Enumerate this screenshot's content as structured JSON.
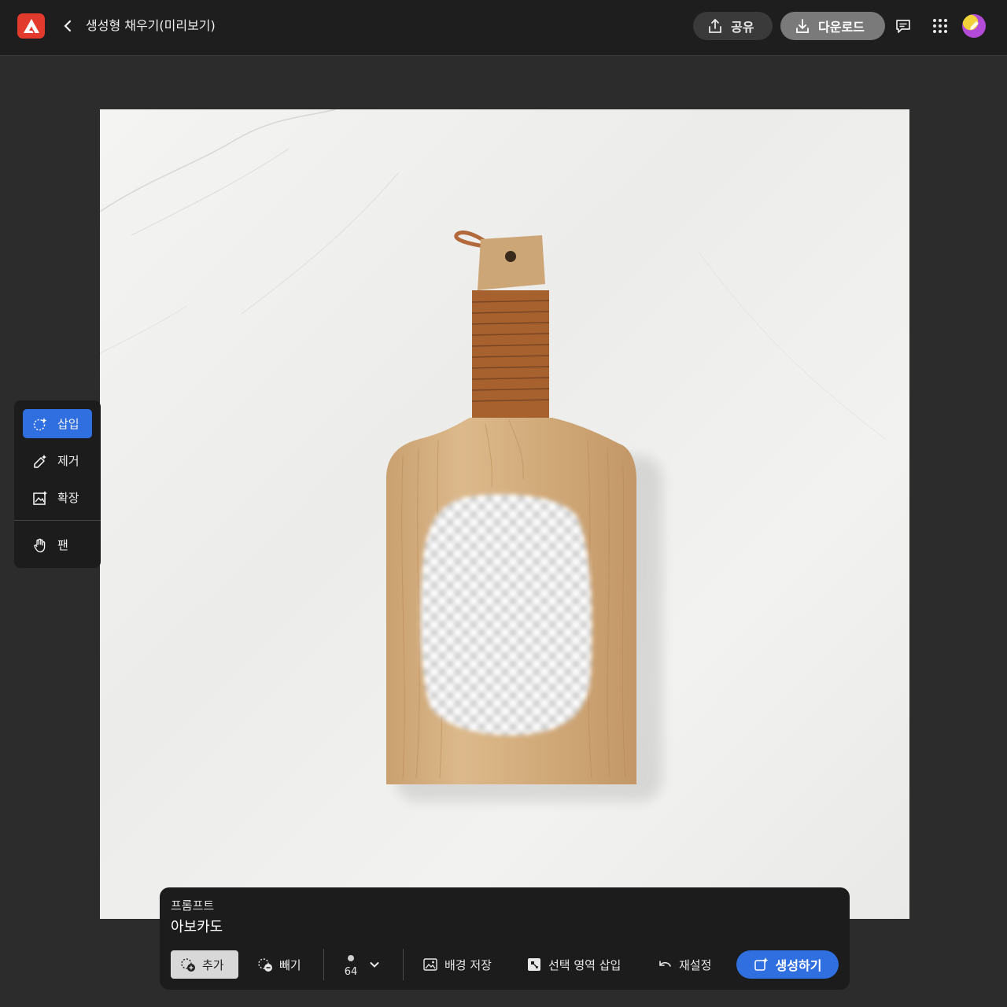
{
  "header": {
    "title": "생성형 채우기(미리보기)",
    "share_label": "공유",
    "download_label": "다운로드",
    "brand_color": "#e23a2d"
  },
  "sidebar": {
    "items": [
      {
        "label": "삽입",
        "icon": "insert-sparkle-icon",
        "active": true
      },
      {
        "label": "제거",
        "icon": "remove-eraser-icon",
        "active": false
      },
      {
        "label": "확장",
        "icon": "expand-image-icon",
        "active": false
      },
      {
        "label": "팬",
        "icon": "hand-icon",
        "active": false
      }
    ]
  },
  "prompt": {
    "label": "프롬프트",
    "value": "아보카도"
  },
  "toolbar": {
    "add_label": "추가",
    "subtract_label": "빼기",
    "brush_size": "64",
    "save_background_label": "배경 저장",
    "insert_selection_label": "선택 영역 삽입",
    "reset_label": "재설정",
    "generate_label": "생성하기"
  },
  "colors": {
    "accent": "#2f6fe0",
    "panel": "#1c1c1c",
    "workspace": "#2c2c2c"
  }
}
